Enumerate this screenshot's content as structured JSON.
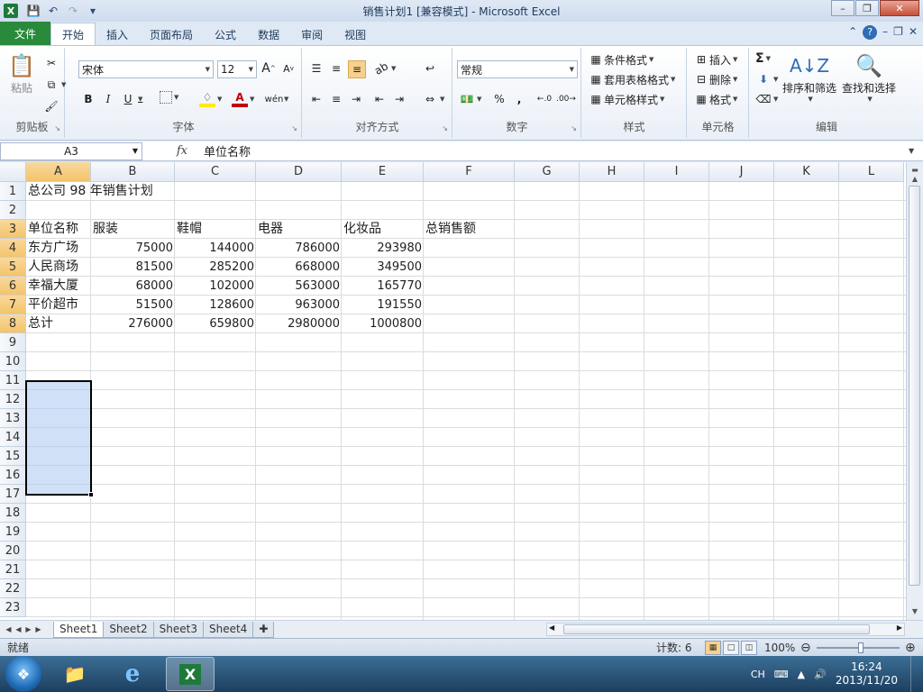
{
  "window": {
    "title": "销售计划1 [兼容模式] - Microsoft Excel",
    "app_icon": "X",
    "accent_color": "#2a8a3c"
  },
  "ribbon_tabs": [
    "文件",
    "开始",
    "插入",
    "页面布局",
    "公式",
    "数据",
    "审阅",
    "视图"
  ],
  "ribbon": {
    "clipboard": {
      "paste": "粘贴",
      "label": "剪贴板"
    },
    "font": {
      "name": "宋体",
      "size": "12",
      "bold": "B",
      "italic": "I",
      "underline": "U",
      "label": "字体"
    },
    "alignment": {
      "label": "对齐方式"
    },
    "number": {
      "format": "常规",
      "percent": "%",
      "comma": ",",
      "label": "数字"
    },
    "styles": {
      "conditional": "条件格式",
      "table": "套用表格格式",
      "cell_styles": "单元格样式",
      "label": "样式"
    },
    "cells": {
      "insert": "插入",
      "delete": "删除",
      "format": "格式",
      "label": "单元格"
    },
    "editing": {
      "sum": "Σ",
      "sort_filter": "排序和筛选",
      "find_select": "查找和选择",
      "label": "编辑"
    }
  },
  "formula_bar": {
    "name_box": "A3",
    "fx": "fx",
    "formula": "单位名称"
  },
  "columns": [
    "A",
    "B",
    "C",
    "D",
    "E",
    "F",
    "G",
    "H",
    "I",
    "J",
    "K",
    "L"
  ],
  "rows": [
    "1",
    "2",
    "3",
    "4",
    "5",
    "6",
    "7",
    "8",
    "9",
    "10",
    "11",
    "12",
    "13",
    "14",
    "15",
    "16",
    "17",
    "18",
    "19",
    "20",
    "21",
    "22",
    "23"
  ],
  "cells": {
    "A1": "总公司 98 年销售计划",
    "A3": "单位名称",
    "B3": "服装",
    "C3": "鞋帽",
    "D3": "电器",
    "E3": "化妆品",
    "F3": "总销售额",
    "A4": "东方广场",
    "B4": "75000",
    "C4": "144000",
    "D4": "786000",
    "E4": "293980",
    "A5": "人民商场",
    "B5": "81500",
    "C5": "285200",
    "D5": "668000",
    "E5": "349500",
    "A6": "幸福大厦",
    "B6": "68000",
    "C6": "102000",
    "D6": "563000",
    "E6": "165770",
    "A7": "平价超市",
    "B7": "51500",
    "C7": "128600",
    "D7": "963000",
    "E7": "191550",
    "A8": "总计",
    "B8": "276000",
    "C8": "659800",
    "D8": "2980000",
    "E8": "1000800"
  },
  "sheets": [
    "Sheet1",
    "Sheet2",
    "Sheet3",
    "Sheet4"
  ],
  "active_sheet": "Sheet1",
  "status": {
    "ready": "就绪",
    "count": "计数: 6",
    "zoom": "100%"
  },
  "taskbar": {
    "ime": "CH",
    "time": "16:24",
    "date": "2013/11/20"
  }
}
